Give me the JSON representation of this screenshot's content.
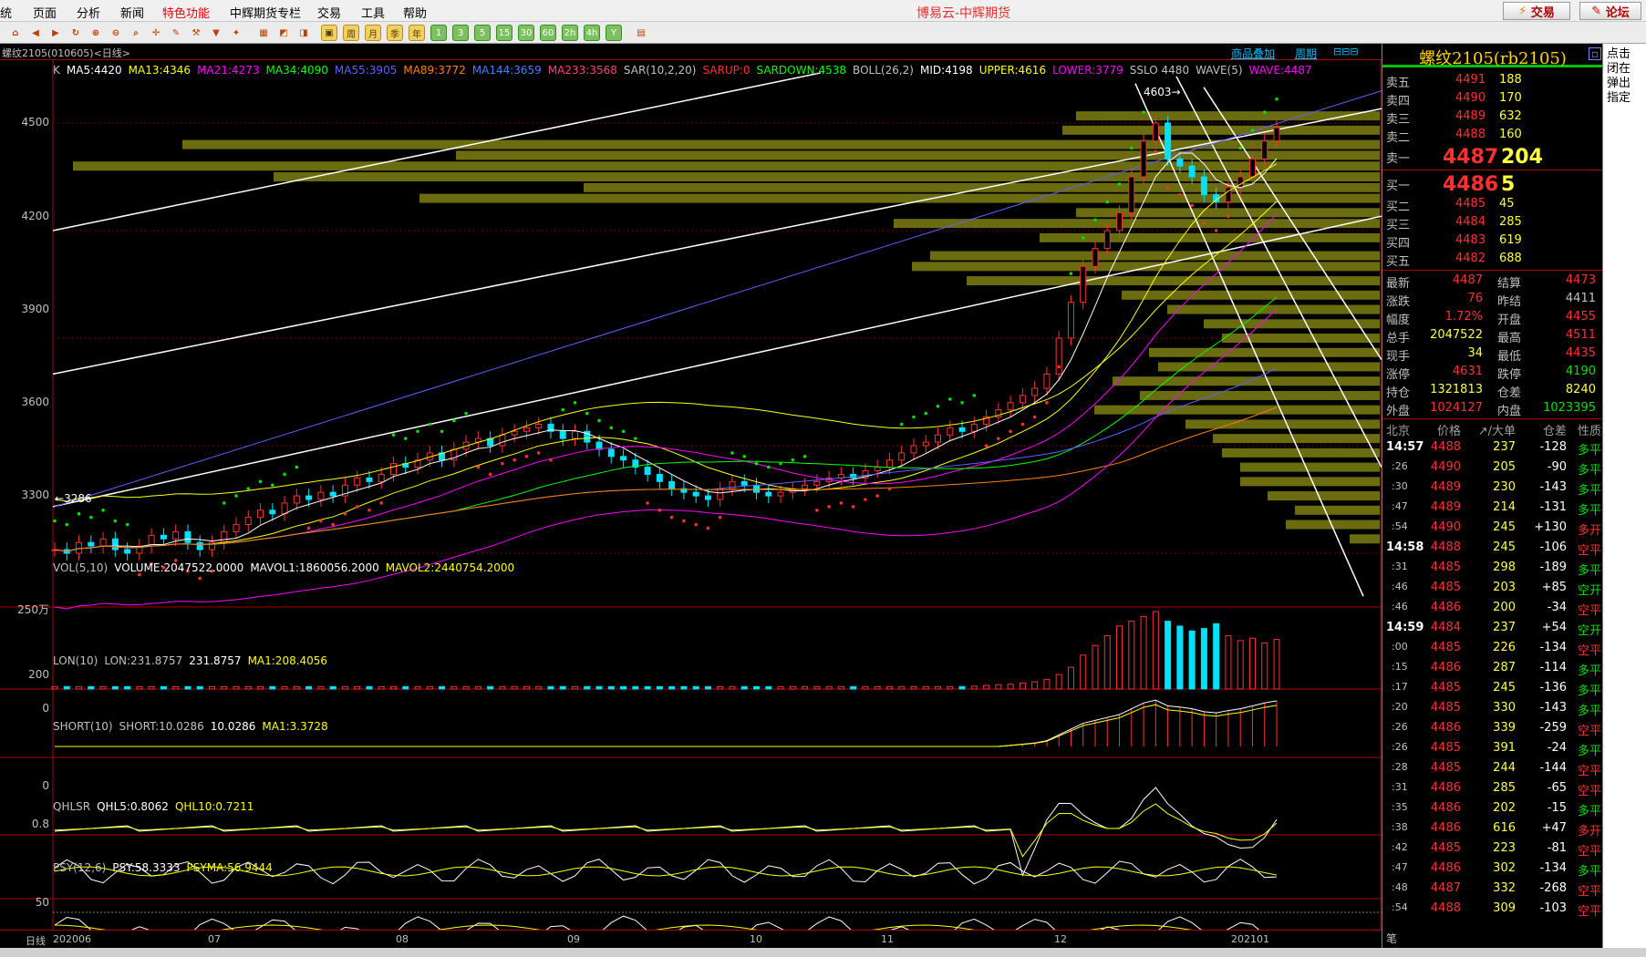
{
  "menu": {
    "items": [
      "统",
      "页面",
      "分析",
      "新闻",
      "特色功能",
      "中辉期货专栏",
      "交易",
      "工具",
      "帮助"
    ],
    "highlight_index": 4
  },
  "app_title": "博易云-中辉期货",
  "top_buttons": {
    "trade": "交易",
    "forum": "论坛"
  },
  "toolbar": {
    "buttons": [
      "周",
      "月",
      "季",
      "年",
      "1",
      "3",
      "5",
      "15",
      "30",
      "60",
      "2h",
      "4h",
      "Y"
    ]
  },
  "chart": {
    "tab_title": "螺纹2105(010605)<日线>",
    "overlay_link": "商品叠加",
    "period_link": "周期",
    "main_indicators": [
      {
        "text": "K",
        "color": "#c0c0c0"
      },
      {
        "text": "MA5:4420",
        "color": "#ffffff"
      },
      {
        "text": "MA13:4346",
        "color": "#ffff00"
      },
      {
        "text": "MA21:4273",
        "color": "#ff00ff"
      },
      {
        "text": "MA34:4090",
        "color": "#00ff00"
      },
      {
        "text": "MA55:3905",
        "color": "#6060ff"
      },
      {
        "text": "MA89:3772",
        "color": "#ff8000"
      },
      {
        "text": "MA144:3659",
        "color": "#4080ff"
      },
      {
        "text": "MA233:3568",
        "color": "#ff4080"
      },
      {
        "text": "SAR(10,2,20)",
        "color": "#c0c0c0"
      },
      {
        "text": "SARUP:0",
        "color": "#ff3030"
      },
      {
        "text": "SARDOWN:4538",
        "color": "#00ff00"
      },
      {
        "text": "BOLL(26,2)",
        "color": "#c0c0c0"
      },
      {
        "text": "MID:4198",
        "color": "#ffffff"
      },
      {
        "text": "UPPER:4616",
        "color": "#ffff00"
      },
      {
        "text": "LOWER:3779",
        "color": "#ff00ff"
      },
      {
        "text": "SSLO 4480",
        "color": "#c0c0c0"
      },
      {
        "text": "WAVE(5)",
        "color": "#c0c0c0"
      },
      {
        "text": "WAVE:4487",
        "color": "#ff00ff"
      }
    ],
    "price_labels": [
      "4500",
      "4200",
      "3900",
      "3600",
      "3300"
    ],
    "high_marker": "4603",
    "low_marker": "3286",
    "vol_panel": {
      "labels": [
        {
          "text": "VOL(5,10)",
          "color": "#c0c0c0"
        },
        {
          "text": "VOLUME:2047522.0000",
          "color": "#ffffff"
        },
        {
          "text": "MAVOL1:1860056.2000",
          "color": "#ffffff"
        },
        {
          "text": "MAVOL2:2440754.2000",
          "color": "#ffff00"
        }
      ],
      "y_label": "250万"
    },
    "lon_panel": {
      "labels": [
        {
          "text": "LON(10)",
          "color": "#c0c0c0"
        },
        {
          "text": "LON:231.8757",
          "color": "#c0c0c0"
        },
        {
          "text": "231.8757",
          "color": "#ffffff"
        },
        {
          "text": "MA1:208.4056",
          "color": "#ffff00"
        }
      ],
      "y_labels": [
        "200",
        "0"
      ]
    },
    "short_panel": {
      "labels": [
        {
          "text": "SHORT(10)",
          "color": "#c0c0c0"
        },
        {
          "text": "SHORT:10.0286",
          "color": "#c0c0c0"
        },
        {
          "text": "10.0286",
          "color": "#ffffff"
        },
        {
          "text": "MA1:3.3728",
          "color": "#ffff00"
        }
      ],
      "y_labels": [
        "0"
      ]
    },
    "qhlsr_panel": {
      "labels": [
        {
          "text": "QHLSR",
          "color": "#c0c0c0"
        },
        {
          "text": "QHL5:0.8062",
          "color": "#ffffff"
        },
        {
          "text": "QHL10:0.7211",
          "color": "#ffff00"
        }
      ],
      "y_labels": [
        "0.8"
      ]
    },
    "psy_panel": {
      "labels": [
        {
          "text": "PSY(12,6)",
          "color": "#c0c0c0"
        },
        {
          "text": "PSY:58.3333",
          "color": "#ffffff"
        },
        {
          "text": "PSYMA:56.9444",
          "color": "#ffff00"
        }
      ],
      "y_labels": [
        "50"
      ]
    },
    "x_axis": {
      "corner": "日线",
      "labels": [
        "202006",
        "07",
        "08",
        "09",
        "10",
        "11",
        "12",
        "202101"
      ]
    }
  },
  "chart_data": {
    "type": "candlestick",
    "title": "螺纹2105(010605)<日线>",
    "x_labels": [
      "202006",
      "07",
      "08",
      "09",
      "10",
      "11",
      "12",
      "202101"
    ],
    "ylim": [
      3150,
      4650
    ],
    "ma": {
      "MA5": 4420,
      "MA13": 4346,
      "MA21": 4273,
      "MA34": 4090,
      "MA55": 3905,
      "MA89": 3772,
      "MA144": 3659,
      "MA233": 3568
    },
    "boll": {
      "MID": 4198,
      "UPPER": 4616,
      "LOWER": 3779
    },
    "sar_down": 4538,
    "high": 4603,
    "low": 3286,
    "close_series": [
      3310,
      3300,
      3330,
      3320,
      3340,
      3310,
      3300,
      3320,
      3350,
      3340,
      3360,
      3330,
      3310,
      3330,
      3360,
      3380,
      3400,
      3420,
      3410,
      3440,
      3460,
      3450,
      3470,
      3460,
      3490,
      3510,
      3500,
      3520,
      3550,
      3540,
      3560,
      3580,
      3560,
      3590,
      3610,
      3620,
      3600,
      3630,
      3640,
      3650,
      3660,
      3640,
      3620,
      3640,
      3610,
      3590,
      3570,
      3560,
      3540,
      3520,
      3500,
      3480,
      3470,
      3460,
      3450,
      3480,
      3500,
      3490,
      3470,
      3460,
      3470,
      3480,
      3490,
      3500,
      3510,
      3520,
      3510,
      3530,
      3540,
      3560,
      3580,
      3600,
      3610,
      3630,
      3650,
      3640,
      3660,
      3680,
      3700,
      3720,
      3740,
      3760,
      3800,
      3900,
      4000,
      4100,
      4150,
      4200,
      4250,
      4350,
      4450,
      4500,
      4400,
      4380,
      4350,
      4300,
      4280,
      4320,
      4350,
      4400,
      4450,
      4487
    ],
    "volume_wan": [
      10,
      10,
      10,
      10,
      10,
      10,
      10,
      10,
      10,
      10,
      10,
      10,
      10,
      10,
      10,
      10,
      10,
      10,
      10,
      10,
      10,
      10,
      10,
      10,
      10,
      10,
      10,
      10,
      10,
      10,
      10,
      10,
      10,
      10,
      10,
      10,
      10,
      10,
      10,
      10,
      10,
      10,
      10,
      10,
      10,
      10,
      10,
      10,
      10,
      10,
      10,
      10,
      10,
      10,
      10,
      10,
      10,
      10,
      10,
      10,
      10,
      10,
      10,
      10,
      10,
      10,
      10,
      10,
      10,
      10,
      10,
      10,
      10,
      10,
      10,
      10,
      12,
      15,
      18,
      20,
      25,
      30,
      40,
      60,
      90,
      140,
      180,
      220,
      260,
      280,
      300,
      320,
      280,
      260,
      240,
      250,
      270,
      220,
      200,
      210,
      190,
      205
    ]
  },
  "quote": {
    "title": "螺纹2105(rb2105)",
    "asks": [
      {
        "label": "卖五",
        "price": "4491",
        "vol": "188"
      },
      {
        "label": "卖四",
        "price": "4490",
        "vol": "170"
      },
      {
        "label": "卖三",
        "price": "4489",
        "vol": "632"
      },
      {
        "label": "卖二",
        "price": "4488",
        "vol": "160"
      }
    ],
    "ask1": {
      "label": "卖一",
      "price": "4487",
      "vol": "204"
    },
    "bid1": {
      "label": "买一",
      "price": "4486",
      "vol": "5"
    },
    "bids": [
      {
        "label": "买二",
        "price": "4485",
        "vol": "45"
      },
      {
        "label": "买三",
        "price": "4484",
        "vol": "285"
      },
      {
        "label": "买四",
        "price": "4483",
        "vol": "619"
      },
      {
        "label": "买五",
        "price": "4482",
        "vol": "688"
      }
    ],
    "stats": [
      {
        "l1": "最新",
        "v1": "4487",
        "c1": "#ff3030",
        "l2": "结算",
        "v2": "4473",
        "c2": "#ff3030"
      },
      {
        "l1": "涨跌",
        "v1": "76",
        "c1": "#ff3030",
        "l2": "昨结",
        "v2": "4411",
        "c2": "#c0c0c0"
      },
      {
        "l1": "幅度",
        "v1": "1.72%",
        "c1": "#ff3030",
        "l2": "开盘",
        "v2": "4455",
        "c2": "#ff3030"
      },
      {
        "l1": "总手",
        "v1": "2047522",
        "c1": "#ffff40",
        "l2": "最高",
        "v2": "4511",
        "c2": "#ff3030"
      },
      {
        "l1": "现手",
        "v1": "34",
        "c1": "#ffff40",
        "l2": "最低",
        "v2": "4435",
        "c2": "#ff3030"
      },
      {
        "l1": "涨停",
        "v1": "4631",
        "c1": "#ff3030",
        "l2": "跌停",
        "v2": "4190",
        "c2": "#00e000"
      },
      {
        "l1": "持仓",
        "v1": "1321813",
        "c1": "#ffff40",
        "l2": "仓差",
        "v2": "8240",
        "c2": "#ffff40"
      },
      {
        "l1": "外盘",
        "v1": "1024127",
        "c1": "#ff3030",
        "l2": "内盘",
        "v2": "1023395",
        "c2": "#00e000"
      }
    ],
    "tick_header": [
      "北京",
      "价格",
      "↗/大单",
      "仓差",
      "性质"
    ],
    "ticks": [
      {
        "t": "14:57",
        "p": "4488",
        "v": "237",
        "d": "-128",
        "n": "多平",
        "pc": "#ff3030",
        "nc": "#00e000",
        "big": true
      },
      {
        "t": ":26",
        "p": "4490",
        "v": "205",
        "d": "-90",
        "n": "多平",
        "pc": "#ff3030",
        "nc": "#00e000",
        "big": false
      },
      {
        "t": ":30",
        "p": "4489",
        "v": "230",
        "d": "-143",
        "n": "多平",
        "pc": "#ff3030",
        "nc": "#00e000",
        "big": false
      },
      {
        "t": ":47",
        "p": "4489",
        "v": "214",
        "d": "-131",
        "n": "多平",
        "pc": "#ff3030",
        "nc": "#00e000",
        "big": false
      },
      {
        "t": ":54",
        "p": "4490",
        "v": "245",
        "d": "+130",
        "n": "多开",
        "pc": "#ff3030",
        "nc": "#ff3030",
        "big": false
      },
      {
        "t": "14:58",
        "p": "4488",
        "v": "245",
        "d": "-106",
        "n": "空平",
        "pc": "#ff3030",
        "nc": "#ff3030",
        "big": true
      },
      {
        "t": ":31",
        "p": "4485",
        "v": "298",
        "d": "-189",
        "n": "多平",
        "pc": "#ff3030",
        "nc": "#00e000",
        "big": false
      },
      {
        "t": ":46",
        "p": "4485",
        "v": "203",
        "d": "+85",
        "n": "空开",
        "pc": "#ff3030",
        "nc": "#00e000",
        "big": false
      },
      {
        "t": ":46",
        "p": "4486",
        "v": "200",
        "d": "-34",
        "n": "空平",
        "pc": "#ff3030",
        "nc": "#ff3030",
        "big": false
      },
      {
        "t": "14:59",
        "p": "4484",
        "v": "237",
        "d": "+54",
        "n": "空开",
        "pc": "#ff3030",
        "nc": "#00e000",
        "big": true
      },
      {
        "t": ":00",
        "p": "4485",
        "v": "226",
        "d": "-134",
        "n": "空平",
        "pc": "#ff3030",
        "nc": "#ff3030",
        "big": false
      },
      {
        "t": ":15",
        "p": "4486",
        "v": "287",
        "d": "-114",
        "n": "多平",
        "pc": "#ff3030",
        "nc": "#00e000",
        "big": false
      },
      {
        "t": ":17",
        "p": "4485",
        "v": "245",
        "d": "-136",
        "n": "多平",
        "pc": "#ff3030",
        "nc": "#00e000",
        "big": false
      },
      {
        "t": ":20",
        "p": "4485",
        "v": "330",
        "d": "-143",
        "n": "多平",
        "pc": "#ff3030",
        "nc": "#00e000",
        "big": false
      },
      {
        "t": ":26",
        "p": "4486",
        "v": "339",
        "d": "-259",
        "n": "空平",
        "pc": "#ff3030",
        "nc": "#ff3030",
        "big": false
      },
      {
        "t": ":26",
        "p": "4485",
        "v": "391",
        "d": "-24",
        "n": "多平",
        "pc": "#ff3030",
        "nc": "#00e000",
        "big": false
      },
      {
        "t": ":28",
        "p": "4485",
        "v": "244",
        "d": "-144",
        "n": "空平",
        "pc": "#ff3030",
        "nc": "#ff3030",
        "big": false
      },
      {
        "t": ":31",
        "p": "4486",
        "v": "285",
        "d": "-65",
        "n": "空平",
        "pc": "#ff3030",
        "nc": "#ff3030",
        "big": false
      },
      {
        "t": ":35",
        "p": "4486",
        "v": "202",
        "d": "-15",
        "n": "多平",
        "pc": "#ff3030",
        "nc": "#00e000",
        "big": false
      },
      {
        "t": ":38",
        "p": "4486",
        "v": "616",
        "d": "+47",
        "n": "多开",
        "pc": "#ff3030",
        "nc": "#ff3030",
        "big": false
      },
      {
        "t": ":42",
        "p": "4485",
        "v": "223",
        "d": "-81",
        "n": "空平",
        "pc": "#ff3030",
        "nc": "#ff3030",
        "big": false
      },
      {
        "t": ":47",
        "p": "4486",
        "v": "302",
        "d": "-134",
        "n": "多平",
        "pc": "#ff3030",
        "nc": "#00e000",
        "big": false
      },
      {
        "t": ":48",
        "p": "4487",
        "v": "332",
        "d": "-268",
        "n": "空平",
        "pc": "#ff3030",
        "nc": "#ff3030",
        "big": false
      },
      {
        "t": ":54",
        "p": "4488",
        "v": "309",
        "d": "-103",
        "n": "空平",
        "pc": "#ff3030",
        "nc": "#ff3030",
        "big": false
      }
    ],
    "footer": "笔"
  },
  "right_strip": {
    "text": "点击闭在弹出指定"
  }
}
